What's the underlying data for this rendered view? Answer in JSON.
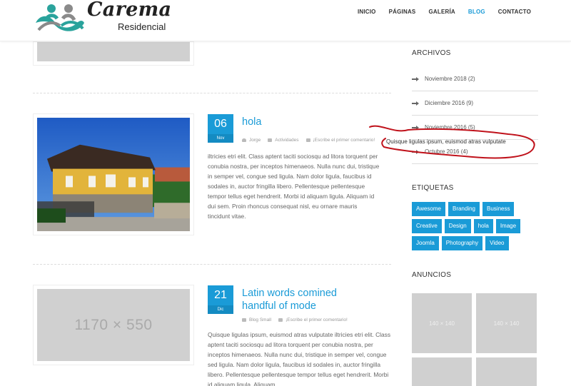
{
  "header": {
    "logo": {
      "name": "Carema",
      "subtitle": "Residencial"
    },
    "nav": [
      {
        "label": "INICIO",
        "active": false
      },
      {
        "label": "PÁGINAS",
        "active": false
      },
      {
        "label": "GALERÍA",
        "active": false
      },
      {
        "label": "BLOG",
        "active": true
      },
      {
        "label": "CONTACTO",
        "active": false
      }
    ]
  },
  "posts": [
    {
      "day": "06",
      "month": "Nov",
      "title": "hola",
      "author": "Jorge",
      "category": "Actividades",
      "comments": "¡Escribe el primer comentario!",
      "excerpt": "iltricies etri elit. Class aptent taciti sociosqu ad litora torquent per conubia nostra, per inceptos himenaeos. Nulla nunc dui, tristique in semper vel, congue sed ligula. Nam dolor ligula, faucibus id sodales in, auctor fringilla libero. Pellentesque pellentesque tempor tellus eget hendrerit. Morbi id aliquam ligula. Aliquam id dui sem. Proin rhoncus consequat nisl, eu ornare mauris tincidunt vitae."
    },
    {
      "day": "21",
      "month": "Dic",
      "title_line1": "Latin words comined",
      "title_line2": "handful of mode",
      "category": "Blog Small",
      "comments": "¡Escribe el primer comentario!",
      "placeholder": "1170 × 550",
      "excerpt": "Quisque ligulas ipsum, euismod atras vulputate iltricies etri elit. Class aptent taciti sociosqu ad litora torquent per conubia nostra, per inceptos himenaeos. Nulla nunc dui, tristique in semper vel, congue sed ligula. Nam dolor ligula, faucibus id sodales in, auctor fringilla libero. Pellentesque pellentesque tempor tellus eget hendrerit. Morbi id aliquam ligula. Aliquam"
    }
  ],
  "sidebar": {
    "archives_title": "ARCHIVOS",
    "archives": [
      "Noviembre 2018 (2)",
      "Diciembre 2016 (9)",
      "Noviembre 2016 (5)",
      "Octubre 2016 (4)"
    ],
    "tags_title": "ETIQUETAS",
    "tags": [
      "Awesome",
      "Branding",
      "Business",
      "Creative",
      "Design",
      "hola",
      "Image",
      "Joomla",
      "Photography",
      "Video"
    ],
    "ads_title": "ANUNCIOS",
    "ad_label": "140 × 140"
  },
  "tooltip": "Quisque ligulas ipsum, euismod atras vulputate",
  "colors": {
    "accent": "#1a9bd7",
    "annotation": "#c0121b",
    "placeholder": "#d0d0d0"
  }
}
